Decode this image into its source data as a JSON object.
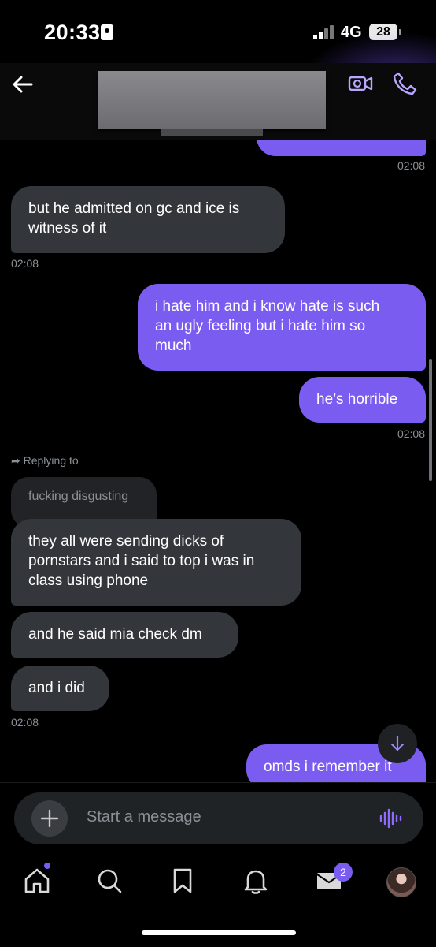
{
  "status_bar": {
    "time": "20:33",
    "network": "4G",
    "battery": "28"
  },
  "composer": {
    "placeholder": "Start a message"
  },
  "nav": {
    "messages_badge": "2"
  },
  "messages": [
    {
      "text": "",
      "time": "02:08"
    },
    {
      "text": "but he admitted on gc and ice is\nwitness of it",
      "time": "02:08"
    },
    {
      "text": "i hate him and i know hate is such\nan ugly feeling but i hate him so\nmuch"
    },
    {
      "text": "he’s horrible",
      "time": "02:08"
    },
    {
      "reply_label": "Replying to",
      "quoted": "fucking disgusting"
    },
    {
      "text": "they all were sending dicks of\npornstars and i said to top i was in\nclass using phone"
    },
    {
      "text": "and he said mia check dm"
    },
    {
      "text": "and i did",
      "time": "02:08"
    },
    {
      "text": "omds i remember it"
    }
  ],
  "colors": {
    "accent": "#7b5cf0",
    "incoming_bubble": "#33363a",
    "background": "#000000"
  },
  "icons": [
    "back-arrow-icon",
    "video-call-icon",
    "phone-icon",
    "scroll-down-icon",
    "plus-icon",
    "voice-waveform-icon",
    "home-icon",
    "search-icon",
    "bookmark-icon",
    "bell-icon",
    "mail-icon"
  ]
}
